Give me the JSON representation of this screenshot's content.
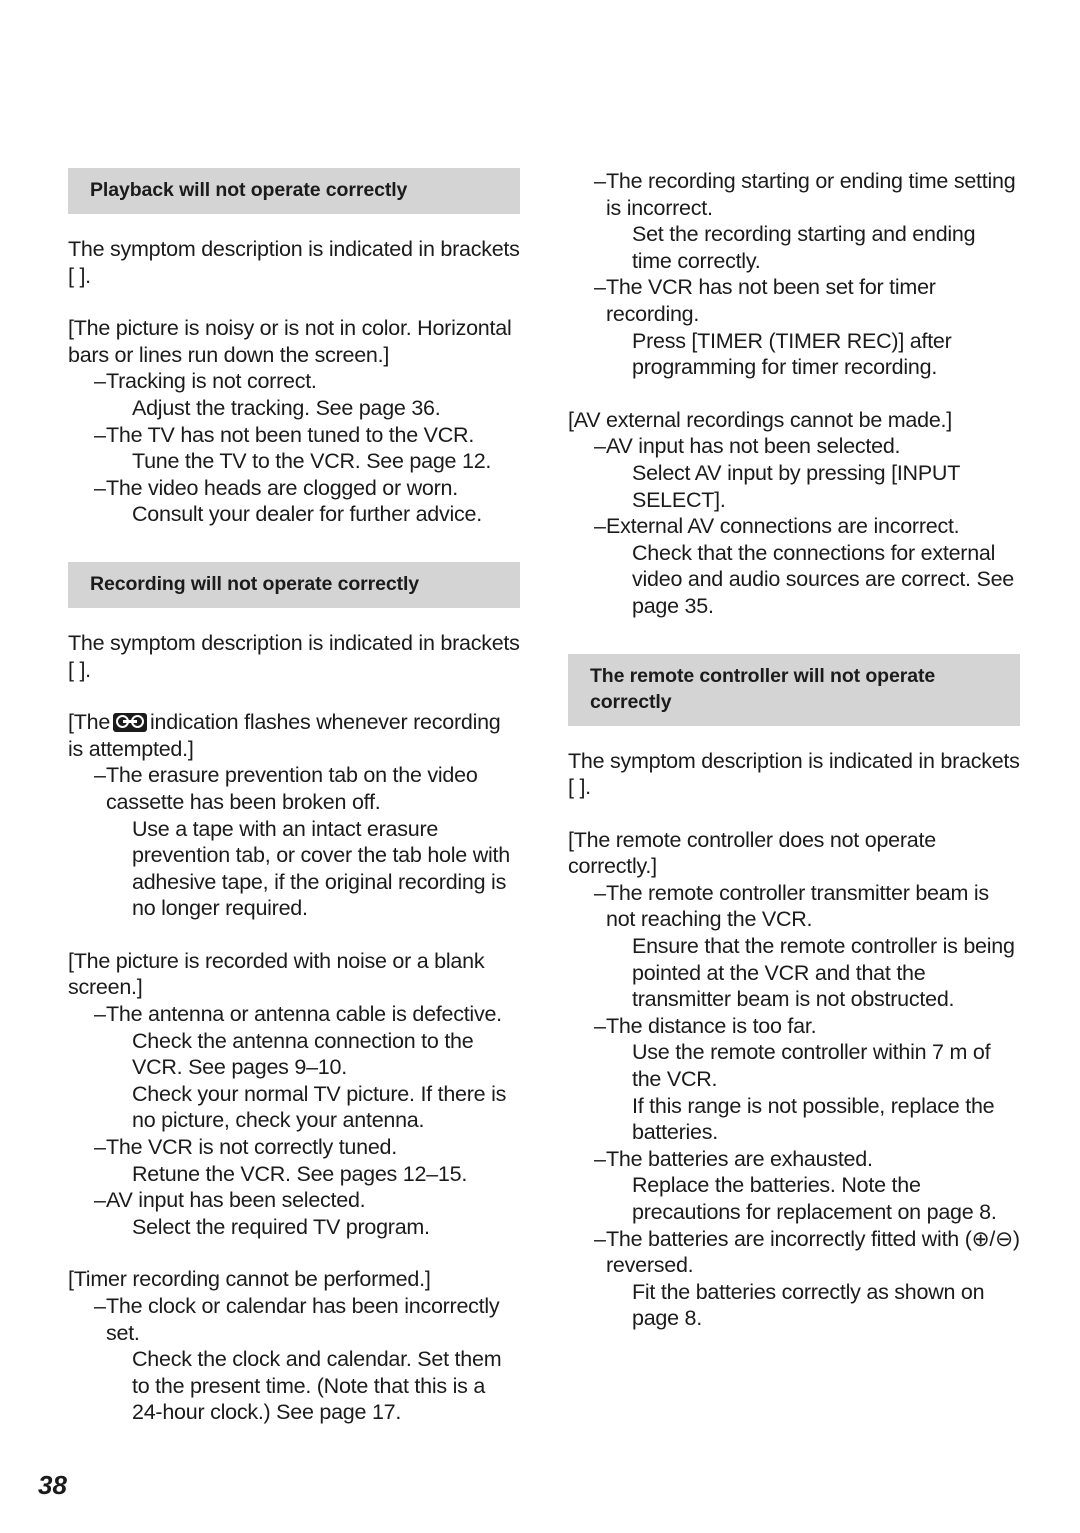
{
  "page": {
    "number": "38"
  },
  "icons": {
    "cassette": "cassette-tape-icon"
  },
  "left_column": {
    "section1": {
      "heading": "Playback will not operate correctly",
      "intro": "The symptom description is indicated in brackets [   ].",
      "symptom": "[The picture is noisy or is not in color. Horizontal bars or lines run down the screen.]",
      "items": [
        {
          "dash": "–",
          "cause": "Tracking is not correct.",
          "remedy": [
            "Adjust the tracking. See page 36."
          ]
        },
        {
          "dash": "–",
          "cause": "The TV has not been tuned to the VCR.",
          "remedy": [
            "Tune the TV to the VCR. See page 12."
          ]
        },
        {
          "dash": "–",
          "cause": "The video heads are clogged or worn.",
          "remedy": [
            "Consult your dealer for further advice."
          ]
        }
      ]
    },
    "section2": {
      "heading": "Recording will not operate correctly",
      "intro": "The symptom description is indicated in brackets [   ].",
      "symptom_a_pre": "[The",
      "symptom_a_post": "indication flashes whenever recording is attempted.]",
      "items_a": [
        {
          "dash": "–",
          "cause": "The erasure prevention tab on the video cassette has been broken off.",
          "remedy": [
            "Use a tape with an intact erasure prevention tab, or cover the tab hole with adhesive tape, if the original recording is no longer required."
          ]
        }
      ],
      "symptom_b": "[The picture is recorded with noise or a blank screen.]",
      "items_b": [
        {
          "dash": "–",
          "cause": "The antenna or antenna cable is defective.",
          "remedy": [
            "Check the antenna connection to the VCR. See pages 9–10.",
            "Check your normal TV picture. If there is no picture, check your antenna."
          ]
        },
        {
          "dash": "–",
          "cause": "The VCR is not correctly tuned.",
          "remedy": [
            "Retune the VCR. See pages 12–15."
          ]
        },
        {
          "dash": "–",
          "cause": "AV input has been selected.",
          "remedy": [
            "Select the required TV program."
          ]
        }
      ],
      "symptom_c": "[Timer recording cannot be performed.]",
      "items_c": [
        {
          "dash": "–",
          "cause": "The clock or calendar has been incorrectly set.",
          "remedy": [
            "Check the clock and calendar. Set them to the present time. (Note that this is a 24-hour clock.) See page 17."
          ]
        }
      ]
    }
  },
  "right_column": {
    "continued_items": [
      {
        "dash": "–",
        "cause": "The recording starting or ending time setting is incorrect.",
        "remedy": [
          "Set the recording starting and ending time correctly."
        ]
      },
      {
        "dash": "–",
        "cause": "The VCR has not been set for timer recording.",
        "remedy": [
          "Press [TIMER (TIMER REC)] after programming for timer recording."
        ]
      }
    ],
    "symptom_av": "[AV external recordings cannot be made.]",
    "items_av": [
      {
        "dash": "–",
        "cause": "AV input has not been selected.",
        "remedy": [
          "Select AV input by pressing [INPUT SELECT]."
        ]
      },
      {
        "dash": "–",
        "cause": "External AV connections are incorrect.",
        "remedy": [
          "Check that the connections for external video and audio sources are correct. See page 35."
        ]
      }
    ],
    "section3": {
      "heading": "The remote controller will not operate correctly",
      "intro": "The symptom description is indicated in brackets [   ].",
      "symptom": "[The remote controller does not operate correctly.]",
      "items": [
        {
          "dash": "–",
          "cause": "The remote controller transmitter beam is not reaching the VCR.",
          "remedy": [
            "Ensure that the remote controller is being pointed at the VCR and that the transmitter beam is not obstructed."
          ]
        },
        {
          "dash": "–",
          "cause": "The distance is too far.",
          "remedy": [
            "Use the remote controller within 7 m of the VCR.",
            "If this range is not possible, replace the batteries."
          ]
        },
        {
          "dash": "–",
          "cause": "The batteries are exhausted.",
          "remedy": [
            "Replace the batteries. Note the precautions for replacement on page 8."
          ]
        },
        {
          "dash": "–",
          "cause": "The batteries are incorrectly fitted with (⊕/⊖) reversed.",
          "remedy": [
            "Fit the batteries correctly as shown on page 8."
          ]
        }
      ]
    }
  }
}
